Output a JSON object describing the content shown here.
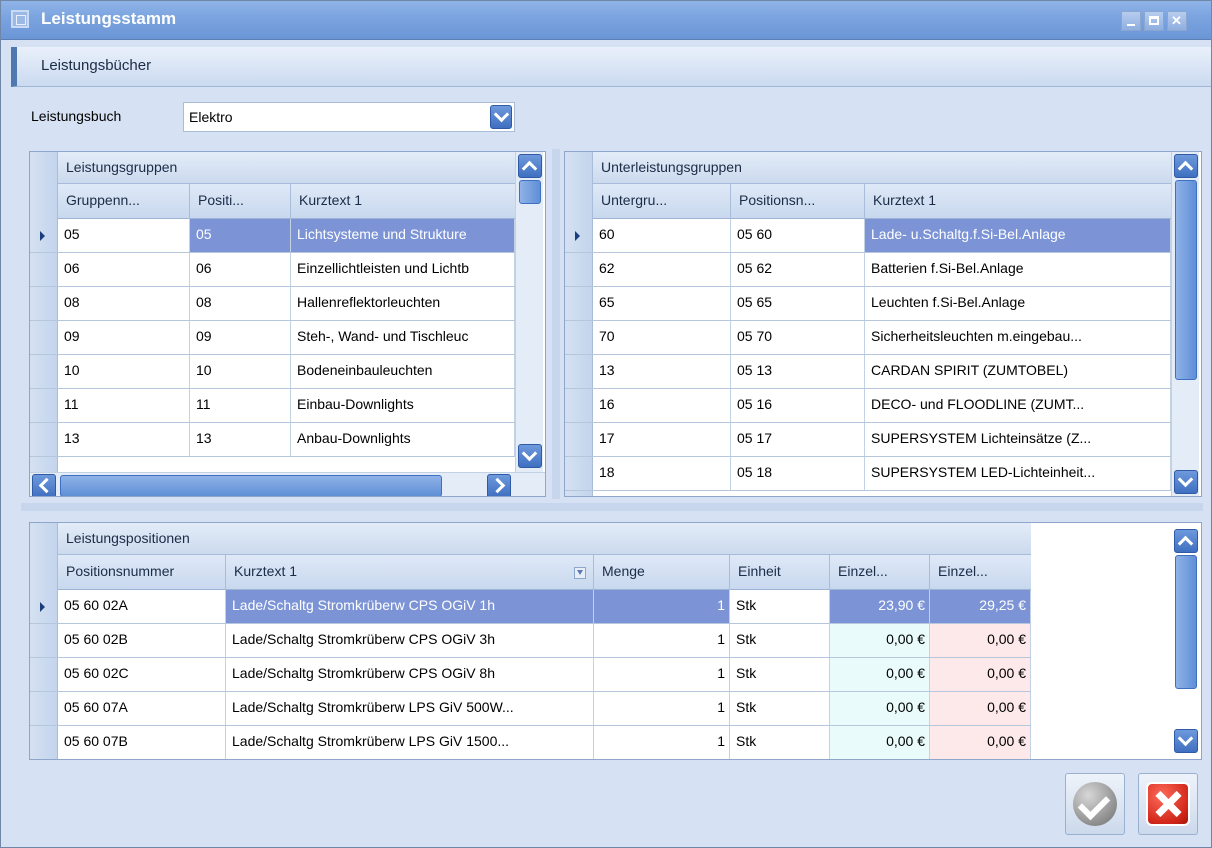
{
  "window": {
    "title": "Leistungsstamm"
  },
  "tab": {
    "label": "Leistungsbücher"
  },
  "leistungsbuch": {
    "label": "Leistungsbuch",
    "value": "Elektro"
  },
  "groups": {
    "title": "Leistungsgruppen",
    "columns": [
      "Gruppenn...",
      "Positi...",
      "Kurztext 1"
    ],
    "rows": [
      [
        "05",
        "05",
        "Lichtsysteme und Strukture"
      ],
      [
        "06",
        "06",
        "Einzellichtleisten und Lichtb"
      ],
      [
        "08",
        "08",
        "Hallenreflektorleuchten"
      ],
      [
        "09",
        "09",
        "Steh-, Wand- und Tischleuc"
      ],
      [
        "10",
        "10",
        "Bodeneinbauleuchten"
      ],
      [
        "11",
        "11",
        "Einbau-Downlights"
      ],
      [
        "13",
        "13",
        "Anbau-Downlights"
      ]
    ]
  },
  "subgroups": {
    "title": "Unterleistungsgruppen",
    "columns": [
      "Untergru...",
      "Positionsn...",
      "Kurztext 1"
    ],
    "rows": [
      [
        "60",
        "05 60",
        "Lade- u.Schaltg.f.Si-Bel.Anlage"
      ],
      [
        "62",
        "05 62",
        "Batterien f.Si-Bel.Anlage"
      ],
      [
        "65",
        "05 65",
        "Leuchten f.Si-Bel.Anlage"
      ],
      [
        "70",
        "05 70",
        "Sicherheitsleuchten m.eingebau..."
      ],
      [
        "13",
        "05 13",
        "CARDAN SPIRIT (ZUMTOBEL)"
      ],
      [
        "16",
        "05 16",
        "DECO- und FLOODLINE (ZUMT..."
      ],
      [
        "17",
        "05 17",
        "SUPERSYSTEM Lichteinsätze (Z..."
      ],
      [
        "18",
        "05 18",
        "SUPERSYSTEM LED-Lichteinheit..."
      ]
    ]
  },
  "positions": {
    "title": "Leistungspositionen",
    "columns": [
      "Positionsnummer",
      "Kurztext 1",
      "Menge",
      "Einheit",
      "Einzel...",
      "Einzel..."
    ],
    "rows": [
      [
        "05 60 02A",
        "Lade/Schaltg Stromkrüberw CPS OGiV 1h",
        "1",
        "Stk",
        "23,90 €",
        "29,25 €"
      ],
      [
        "05 60 02B",
        "Lade/Schaltg Stromkrüberw CPS OGiV 3h",
        "1",
        "Stk",
        "0,00 €",
        "0,00 €"
      ],
      [
        "05 60 02C",
        "Lade/Schaltg Stromkrüberw CPS OGiV 8h",
        "1",
        "Stk",
        "0,00 €",
        "0,00 €"
      ],
      [
        "05 60 07A",
        "Lade/Schaltg Stromkrüberw LPS GiV 500W...",
        "1",
        "Stk",
        "0,00 €",
        "0,00 €"
      ],
      [
        "05 60 07B",
        "Lade/Schaltg Stromkrüberw LPS GiV 1500...",
        "1",
        "Stk",
        "0,00 €",
        "0,00 €"
      ]
    ]
  },
  "icons": {
    "ok": "check-icon",
    "cancel": "close-icon",
    "scroll_up": "chevron-up-icon",
    "scroll_down": "chevron-down-icon"
  },
  "colors": {
    "selection": "#7c94d6",
    "price_green": "#e9fbfb",
    "price_red": "#fde8ea",
    "titlebar": "#7aa3df"
  }
}
